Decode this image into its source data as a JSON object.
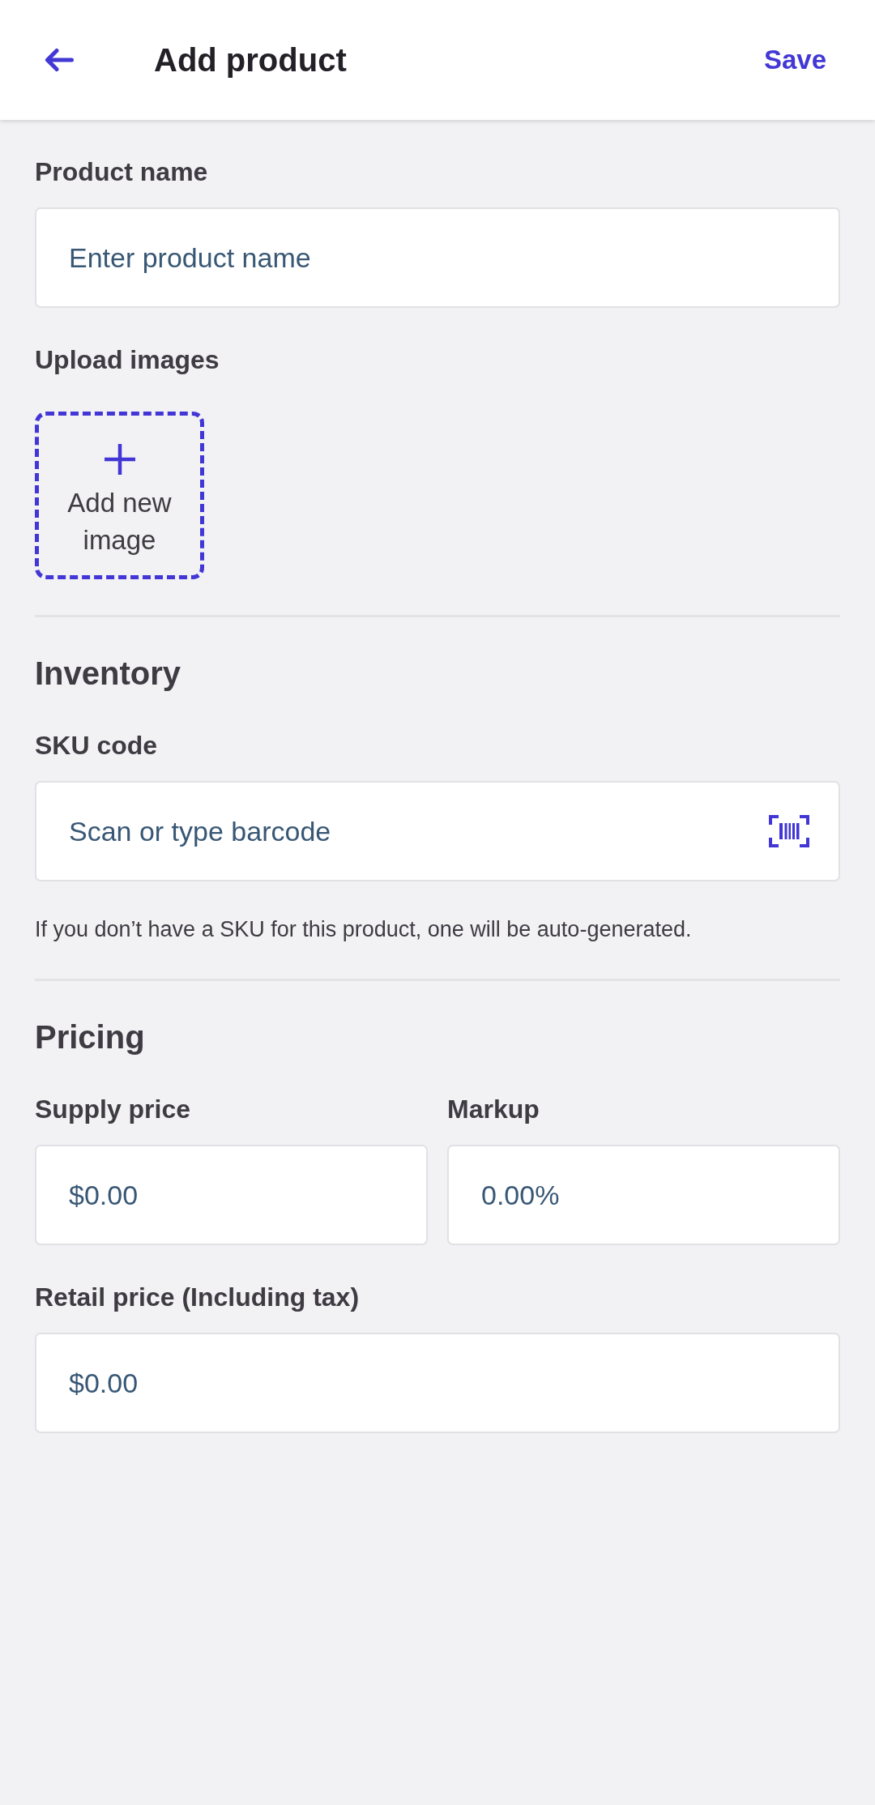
{
  "header": {
    "title": "Add product",
    "action": "Save"
  },
  "sections": [
    {
      "rows": [
        [
          {
            "kind": "text",
            "label": "Product name",
            "placeholder": "Enter product name"
          }
        ],
        [
          {
            "kind": "image_upload",
            "label": "Upload images",
            "button": "Add new image"
          }
        ]
      ]
    },
    {
      "heading": "Inventory",
      "rows": [
        [
          {
            "kind": "barcode",
            "label": "SKU code",
            "placeholder": "Scan or type barcode",
            "hint": "If you don’t have a SKU for this product, one will be auto-generated."
          }
        ]
      ]
    },
    {
      "heading": "Pricing",
      "rows": [
        [
          {
            "kind": "text",
            "label": "Supply price",
            "placeholder": "$0.00"
          },
          {
            "kind": "text",
            "label": "Markup",
            "placeholder": "0.00%"
          }
        ],
        [
          {
            "kind": "text",
            "label": "Retail price (Including tax)",
            "placeholder": "$0.00"
          }
        ]
      ]
    }
  ]
}
